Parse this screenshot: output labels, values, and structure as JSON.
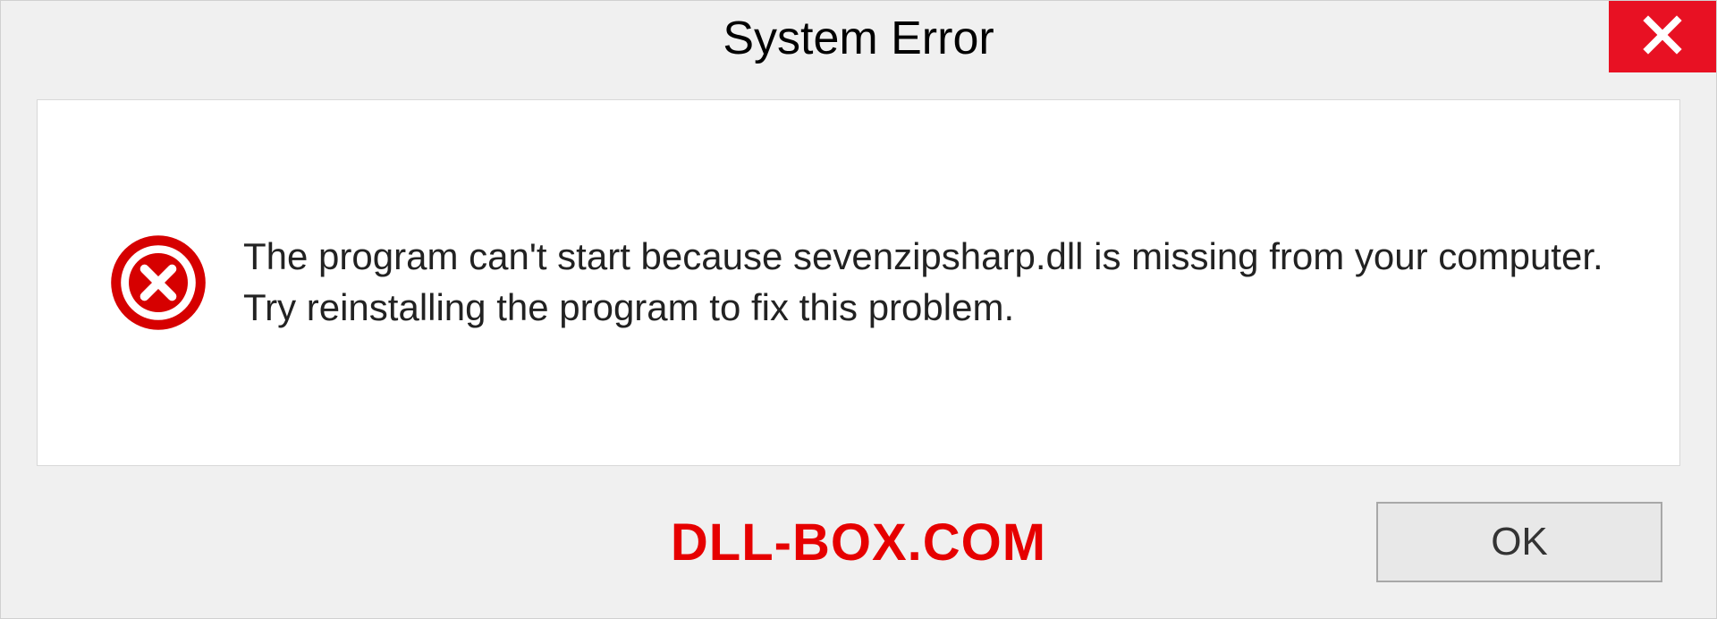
{
  "dialog": {
    "title": "System Error",
    "message": "The program can't start because sevenzipsharp.dll is missing from your computer. Try reinstalling the program to fix this problem.",
    "ok_label": "OK"
  },
  "watermark": "DLL-BOX.COM",
  "colors": {
    "close_bg": "#e81123",
    "error_icon": "#d60000",
    "watermark": "#e60000"
  }
}
